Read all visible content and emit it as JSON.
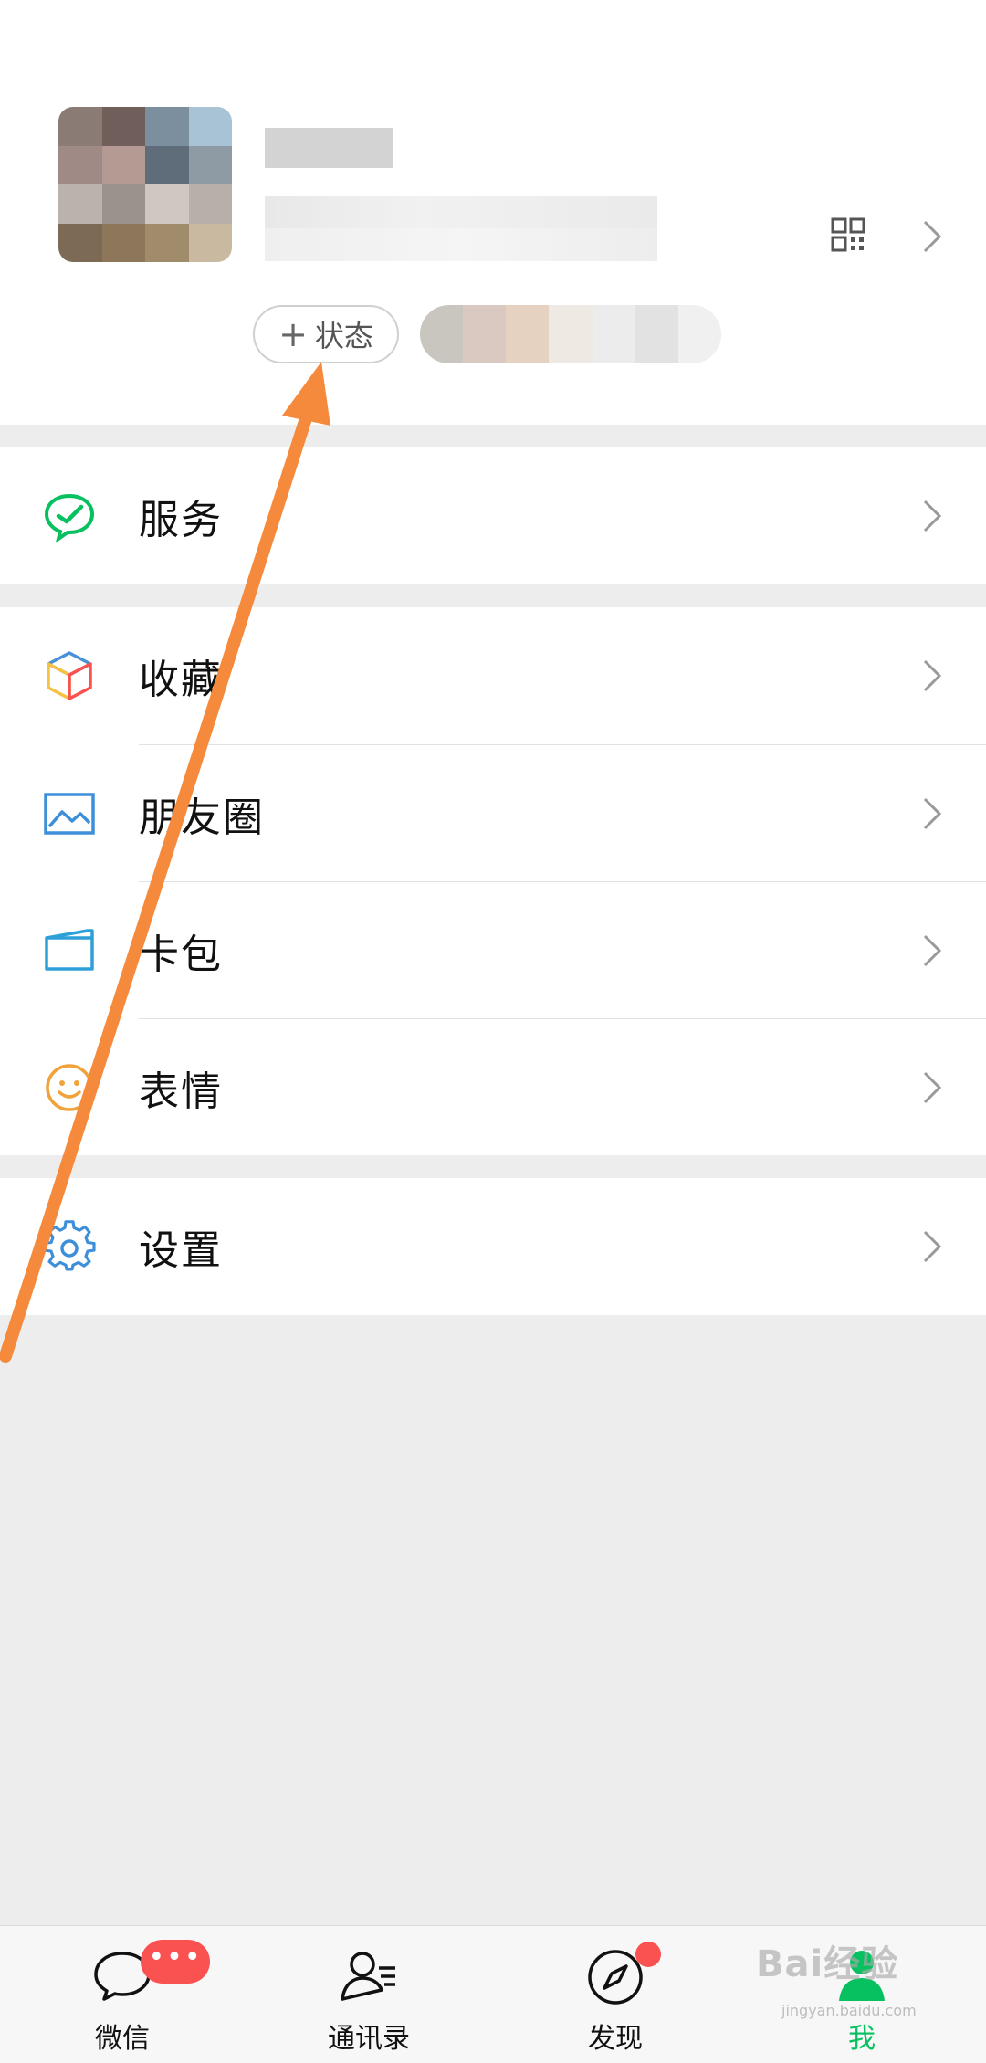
{
  "profile": {
    "status_label": "状态",
    "plus_glyph": "+"
  },
  "menu": {
    "services": "服务",
    "favorites": "收藏",
    "moments": "朋友圈",
    "cards": "卡包",
    "stickers": "表情",
    "settings": "设置"
  },
  "tabs": {
    "chats": "微信",
    "contacts": "通讯录",
    "discover": "发现",
    "me": "我"
  },
  "badges": {
    "chats": "•••"
  },
  "watermark": {
    "text": "Bai经验",
    "sub": "jingyan.baidu.com"
  },
  "colors": {
    "accent_green": "#07c160",
    "badge_red": "#fa5151",
    "annotation_arrow": "#f68a3c"
  }
}
